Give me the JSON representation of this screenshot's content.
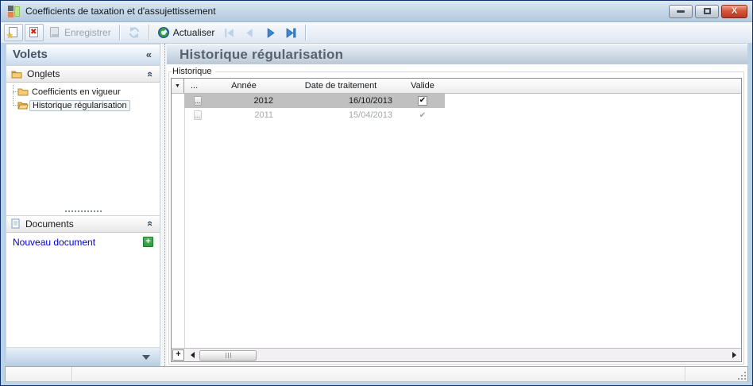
{
  "titlebar": {
    "title": "Coefficients de taxation et d'assujettissement"
  },
  "toolbar": {
    "save_label": "Enregistrer",
    "refresh_label": "Actualiser"
  },
  "sidebar": {
    "title": "Volets",
    "collapse_glyph": "«",
    "onglets": {
      "label": "Onglets",
      "items": [
        {
          "label": "Coefficients en vigueur"
        },
        {
          "label": "Historique régularisation"
        }
      ]
    },
    "documents": {
      "label": "Documents",
      "new_link": "Nouveau document",
      "add_glyph": "+"
    }
  },
  "main": {
    "title": "Historique régularisation",
    "group_label": "Historique",
    "grid": {
      "indicator_glyph": "▼",
      "columns": {
        "rowbtn": "...",
        "annee": "Année",
        "date": "Date de traitement",
        "valide": "Valide"
      },
      "rows": [
        {
          "btn": "...",
          "annee": "2012",
          "date": "16/10/2013",
          "check": "✔"
        },
        {
          "btn": "...",
          "annee": "2011",
          "date": "15/04/2013",
          "check": "✔"
        }
      ],
      "add_button": "+"
    }
  },
  "icons": {
    "new_document": "page-with-star",
    "delete": "page-with-red-x",
    "save": "gray-page",
    "refresh": "circular-arrows",
    "actualiser": "green-blue-refresh-orb",
    "nav": [
      "first",
      "previous",
      "next",
      "last"
    ]
  },
  "colors": {
    "title_gradient_top": "#dbe7f3",
    "title_gradient_bottom": "#b2c9de",
    "selection_gray": "#c0c0c0",
    "link_blue": "#0000c8",
    "nav_enabled_blue": "#3f88d4",
    "nav_disabled_blue": "#bdd2e9",
    "close_button_red": "#c93a2a",
    "plus_green": "#2f9e3f",
    "header_text": "#57626e"
  }
}
